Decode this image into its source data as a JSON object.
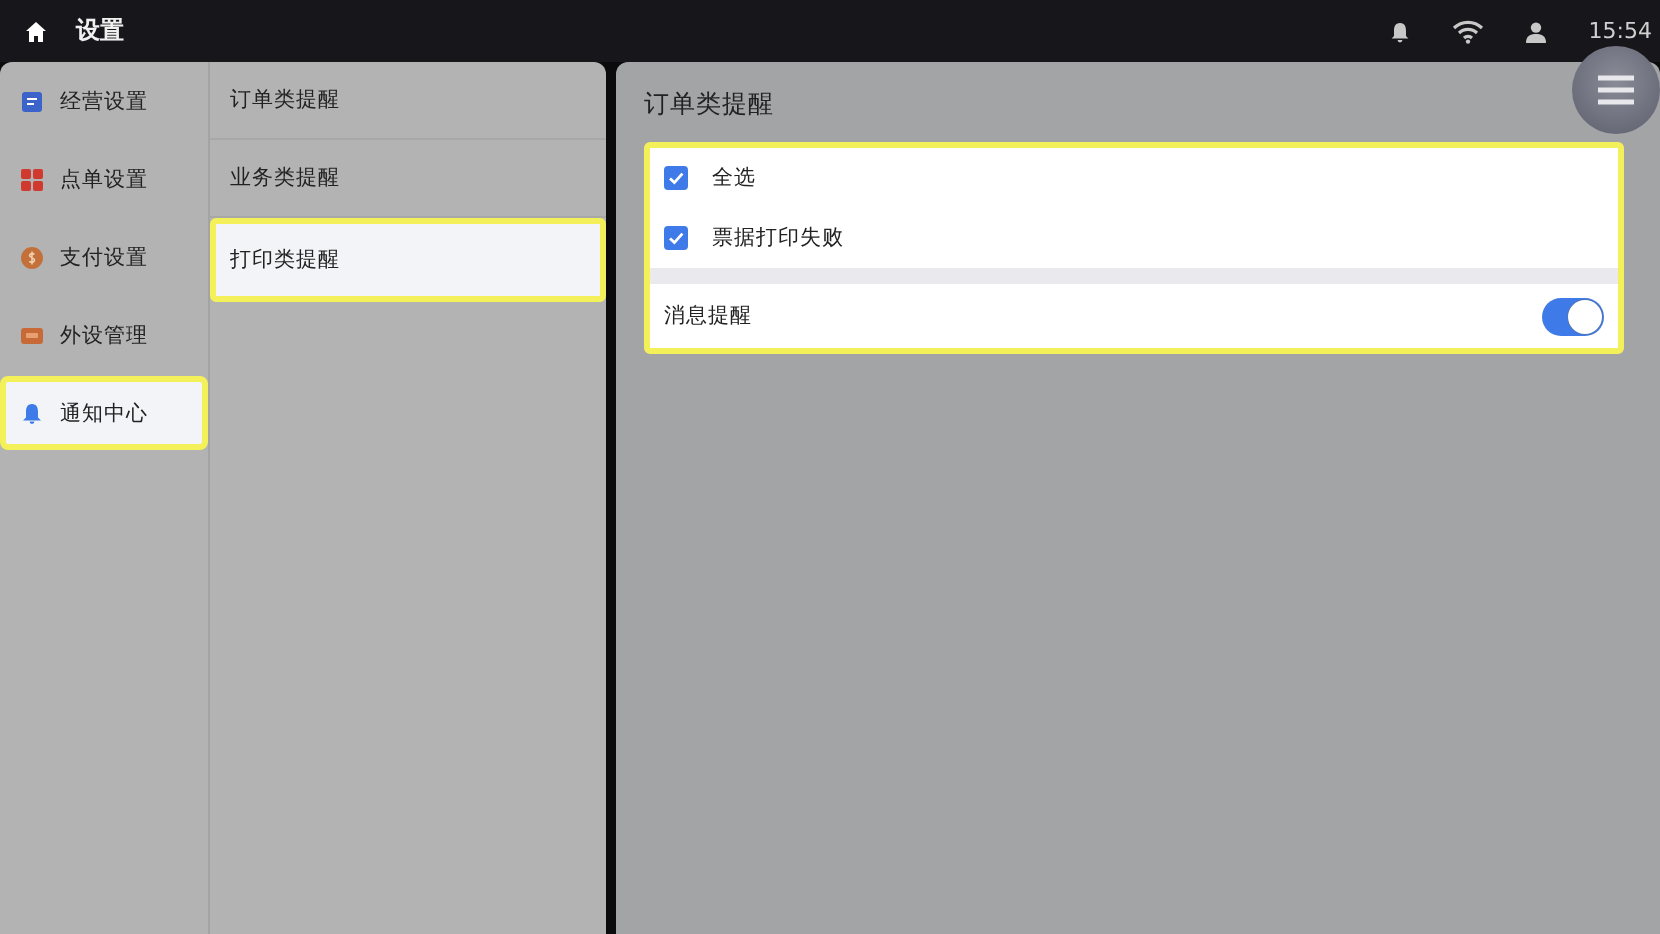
{
  "status_bar": {
    "title": "设置",
    "time": "15:54"
  },
  "nav": [
    {
      "label": "经营设置",
      "kind": "form",
      "selected": false
    },
    {
      "label": "点单设置",
      "kind": "grid",
      "selected": false
    },
    {
      "label": "支付设置",
      "kind": "coin",
      "selected": false
    },
    {
      "label": "外设管理",
      "kind": "device",
      "selected": false
    },
    {
      "label": "通知中心",
      "kind": "bell",
      "selected": true
    }
  ],
  "subnav": [
    {
      "label": "订单类提醒",
      "selected": false
    },
    {
      "label": "业务类提醒",
      "selected": false
    },
    {
      "label": "打印类提醒",
      "selected": true
    }
  ],
  "panel": {
    "title": "订单类提醒",
    "groups": [
      {
        "items": [
          {
            "kind": "checkbox",
            "label": "全选",
            "checked": true
          },
          {
            "kind": "checkbox",
            "label": "票据打印失败",
            "checked": true
          }
        ]
      },
      {
        "items": [
          {
            "kind": "switch",
            "label": "消息提醒",
            "on": true
          }
        ]
      }
    ]
  }
}
